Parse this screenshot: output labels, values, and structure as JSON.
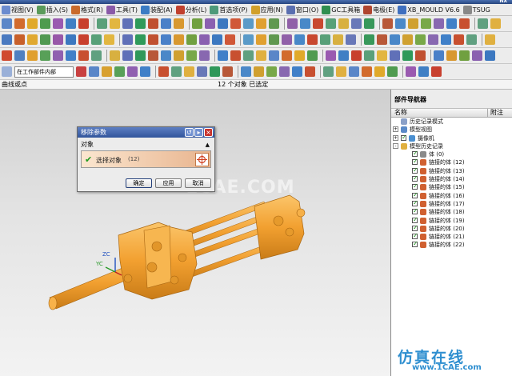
{
  "app": {
    "title_right": "NX"
  },
  "menu": [
    {
      "label": "视图(V)",
      "color": "#6b8ccf"
    },
    {
      "label": "插入(S)",
      "color": "#5a9b5a"
    },
    {
      "label": "格式(R)",
      "color": "#c96a2b"
    },
    {
      "label": "工具(T)",
      "color": "#8a5aa8"
    },
    {
      "label": "装配(A)",
      "color": "#3b7cc4"
    },
    {
      "label": "分析(L)",
      "color": "#c1402e"
    },
    {
      "label": "首选项(P)",
      "color": "#4e9a7a"
    },
    {
      "label": "应用(N)",
      "color": "#d1a02a"
    },
    {
      "label": "窗口(O)",
      "color": "#5a6fb0"
    },
    {
      "label": "GC工具箱",
      "color": "#2f8f4f"
    },
    {
      "label": "电极(E)",
      "color": "#b0452f"
    },
    {
      "label": "XB_MOULD V6.6",
      "color": "#3f6fbf"
    },
    {
      "label": "TSUG",
      "color": "#888888"
    }
  ],
  "toolbar": {
    "row1": [
      "#5a86c8",
      "#d26b2c",
      "#e0a92a",
      "#4f9b4f",
      "#9a5ab0",
      "#3f7fc4",
      "#c8402e",
      "#5aa07a",
      "#e2b640",
      "#6070b8",
      "#2f9a5a",
      "#c05030",
      "#4a80c8",
      "#d89830",
      "#70a040",
      "#8a60b0",
      "#3c78c0",
      "#d05838",
      "#5a9ac8",
      "#e0a030",
      "#609850",
      "#9060a8",
      "#4888c8",
      "#c84830",
      "#58a078",
      "#d8b040",
      "#6878b8",
      "#38985a",
      "#b85838",
      "#4a88c8",
      "#d0a030",
      "#78a848",
      "#8868b0",
      "#4080c8",
      "#c85030",
      "#60a080",
      "#e0b040"
    ],
    "row2": [
      "#4a7ac0",
      "#c8602a",
      "#e0a830",
      "#509850",
      "#9858a8",
      "#3c78c0",
      "#c8402e",
      "#58a078",
      "#e2b640",
      "#6070b8",
      "#2f9a5a",
      "#c05030",
      "#4a80c8",
      "#d89830",
      "#70a040",
      "#8a60b0",
      "#3c78c0",
      "#d05838",
      "#5a9ac8",
      "#e0a030",
      "#609850",
      "#9060a8",
      "#4888c8",
      "#c84830",
      "#58a078",
      "#d8b040",
      "#6878b8",
      "#38985a",
      "#b85838",
      "#4a88c8",
      "#d0a030",
      "#78a848",
      "#8868b0",
      "#4080c8",
      "#c85030",
      "#60a080",
      "#e0b040"
    ],
    "row3": [
      "#d04a30",
      "#5080c0",
      "#e0a030",
      "#58a058",
      "#9060b0",
      "#4080c8",
      "#c85030",
      "#60a080",
      "#d8b040",
      "#6070b8",
      "#30985a",
      "#b85838",
      "#4a88c8",
      "#d0a030",
      "#78a848",
      "#8868b0",
      "#4080c8",
      "#c85030",
      "#60a080",
      "#e0b040",
      "#5a86c8",
      "#d26b2c",
      "#e0a92a",
      "#4f9b4f",
      "#9a5ab0",
      "#3f7fc4",
      "#c8402e",
      "#5aa07a",
      "#e2b640",
      "#6070b8",
      "#2f9a5a",
      "#c05030",
      "#4a80c8",
      "#d89830",
      "#70a040",
      "#8a60b0",
      "#3c78c0"
    ],
    "filter_label": "在工作部件内部",
    "row4": [
      "#c84040",
      "#5a86c8",
      "#d8a030",
      "#58a058",
      "#9060b0",
      "#4080c8",
      "#c85030",
      "#60a080",
      "#e0b040",
      "#6878b8",
      "#30985a",
      "#b85838",
      "#4a88c8",
      "#d0a030",
      "#78a848",
      "#8868b0",
      "#4080c8",
      "#c85030",
      "#60a080",
      "#e0b040",
      "#5a86c8",
      "#d26b2c",
      "#e0a92a",
      "#4f9b4f",
      "#9a5ab0",
      "#3f7fc4",
      "#c8402e"
    ]
  },
  "cue": {
    "left": "曲线或点",
    "selection": "12 个对象 已选定"
  },
  "viewport": {
    "watermark": "1CAE.COM",
    "triad": {
      "zc": "ZC",
      "yc": "YC"
    },
    "model_color": "#f2a030"
  },
  "dialog": {
    "title": "移除参数",
    "group": "对象",
    "select_label": "选择对象",
    "select_count": "(12)",
    "ok": "确定",
    "apply": "应用",
    "cancel": "取消"
  },
  "navigator": {
    "title": "部件导航器",
    "col_name": "名称",
    "col_note": "附注",
    "rows": [
      {
        "indent": 0,
        "exp": "",
        "icon": "#8aa0c8",
        "cb": false,
        "label": "历史记录模式"
      },
      {
        "indent": 0,
        "exp": "+",
        "icon": "#5a8ac8",
        "cb": false,
        "label": "模型视图"
      },
      {
        "indent": 0,
        "exp": "+",
        "icon": "#4a8fd0",
        "cb": true,
        "label": "摄像机"
      },
      {
        "indent": 0,
        "exp": "-",
        "icon": "#e0b040",
        "cb": false,
        "label": "模型历史记录"
      },
      {
        "indent": 1,
        "exp": "",
        "icon": "#8a8a8a",
        "cb": true,
        "label": "体 (0)"
      },
      {
        "indent": 1,
        "exp": "",
        "icon": "#d06030",
        "cb": true,
        "label": "链接的体 (12)"
      },
      {
        "indent": 1,
        "exp": "",
        "icon": "#d06030",
        "cb": true,
        "label": "链接的体 (13)"
      },
      {
        "indent": 1,
        "exp": "",
        "icon": "#d06030",
        "cb": true,
        "label": "链接的体 (14)"
      },
      {
        "indent": 1,
        "exp": "",
        "icon": "#d06030",
        "cb": true,
        "label": "链接的体 (15)"
      },
      {
        "indent": 1,
        "exp": "",
        "icon": "#d06030",
        "cb": true,
        "label": "链接的体 (16)"
      },
      {
        "indent": 1,
        "exp": "",
        "icon": "#d06030",
        "cb": true,
        "label": "链接的体 (17)"
      },
      {
        "indent": 1,
        "exp": "",
        "icon": "#d06030",
        "cb": true,
        "label": "链接的体 (18)"
      },
      {
        "indent": 1,
        "exp": "",
        "icon": "#d06030",
        "cb": true,
        "label": "链接的体 (19)"
      },
      {
        "indent": 1,
        "exp": "",
        "icon": "#d06030",
        "cb": true,
        "label": "链接的体 (20)"
      },
      {
        "indent": 1,
        "exp": "",
        "icon": "#d06030",
        "cb": true,
        "label": "链接的体 (21)"
      },
      {
        "indent": 1,
        "exp": "",
        "icon": "#d06030",
        "cb": true,
        "label": "链接的体 (22)"
      }
    ],
    "brand_cn": "仿真在线",
    "brand_url": "www.1CAE.com"
  }
}
